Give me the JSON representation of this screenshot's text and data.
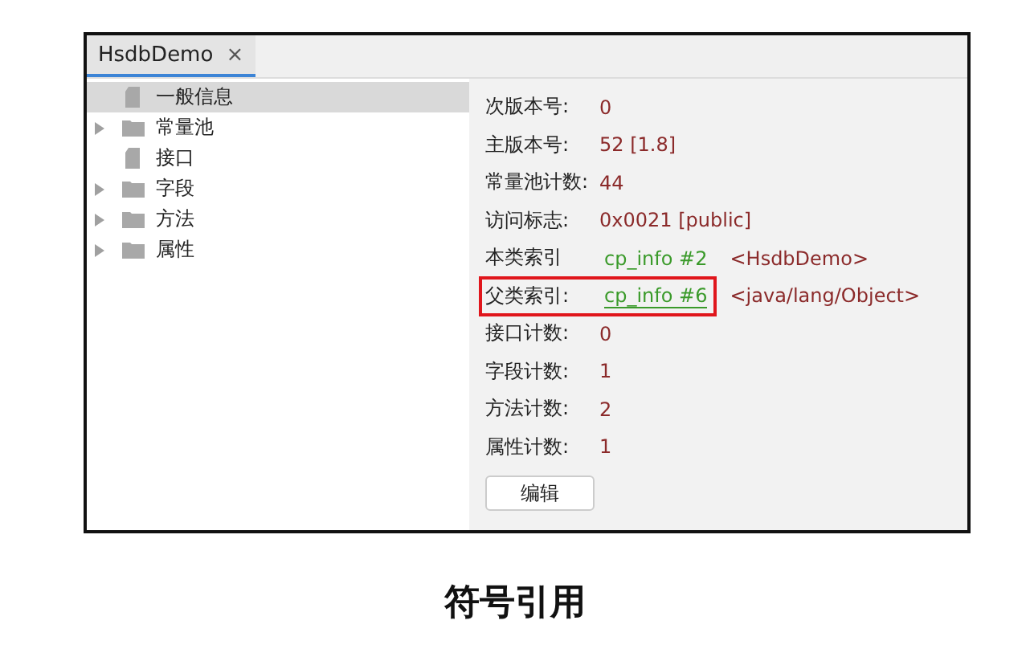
{
  "tab": {
    "title": "HsdbDemo",
    "close": "×",
    "selected": true
  },
  "tree": [
    {
      "label": "一般信息",
      "kind": "file",
      "selected": true,
      "expandable": false
    },
    {
      "label": "常量池",
      "kind": "folder",
      "selected": false,
      "expandable": true
    },
    {
      "label": "接口",
      "kind": "file",
      "selected": false,
      "expandable": false
    },
    {
      "label": "字段",
      "kind": "folder",
      "selected": false,
      "expandable": true
    },
    {
      "label": "方法",
      "kind": "folder",
      "selected": false,
      "expandable": true
    },
    {
      "label": "属性",
      "kind": "folder",
      "selected": false,
      "expandable": true
    }
  ],
  "fields": [
    {
      "label": "次版本号:",
      "value": "0",
      "kind": "text",
      "highlighted": false
    },
    {
      "label": "主版本号:",
      "value": "52 [1.8]",
      "kind": "text",
      "highlighted": false
    },
    {
      "label": "常量池计数:",
      "value": "44",
      "kind": "text",
      "highlighted": false
    },
    {
      "label": "访问标志:",
      "value": "0x0021 [public]",
      "kind": "text",
      "highlighted": false
    },
    {
      "label": "本类索引",
      "value": "cp_info #2",
      "kind": "link",
      "target": "<HsdbDemo>",
      "highlighted": false
    },
    {
      "label": "父类索引:",
      "value": "cp_info #6",
      "kind": "link",
      "target": "<java/lang/Object>",
      "highlighted": true
    },
    {
      "label": "接口计数:",
      "value": "0",
      "kind": "text",
      "highlighted": false
    },
    {
      "label": "字段计数:",
      "value": "1",
      "kind": "text",
      "highlighted": false
    },
    {
      "label": "方法计数:",
      "value": "2",
      "kind": "text",
      "highlighted": false
    },
    {
      "label": "属性计数:",
      "value": "1",
      "kind": "text",
      "highlighted": false
    }
  ],
  "button": "编辑",
  "caption": "符号引用"
}
